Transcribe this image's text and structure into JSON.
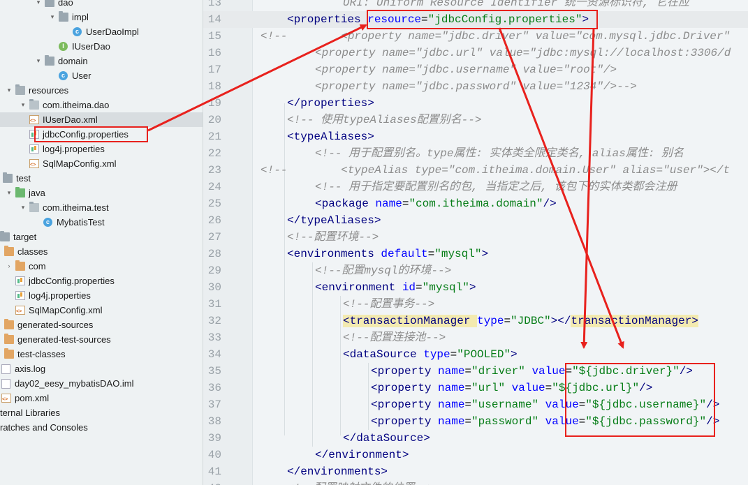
{
  "project_tree": {
    "items": [
      {
        "label": "dao",
        "icon": "folder-icon",
        "arrow": "down"
      },
      {
        "label": "impl",
        "icon": "folder-icon",
        "arrow": "down"
      },
      {
        "label": "UserDaoImpl",
        "icon": "class-icon",
        "arrow": ""
      },
      {
        "label": "IUserDao",
        "icon": "interface-icon",
        "arrow": ""
      },
      {
        "label": "domain",
        "icon": "folder-icon",
        "arrow": "down"
      },
      {
        "label": "User",
        "icon": "class-icon",
        "arrow": ""
      },
      {
        "label": "resources",
        "icon": "resources-folder-icon",
        "arrow": "down"
      },
      {
        "label": "com.itheima.dao",
        "icon": "package-icon",
        "arrow": "down"
      },
      {
        "label": "IUserDao.xml",
        "icon": "xml-file-icon",
        "arrow": ""
      },
      {
        "label": "jdbcConfig.properties",
        "icon": "properties-file-icon",
        "arrow": ""
      },
      {
        "label": "log4j.properties",
        "icon": "properties-file-icon",
        "arrow": ""
      },
      {
        "label": "SqlMapConfig.xml",
        "icon": "xml-file-icon",
        "arrow": ""
      },
      {
        "label": "test",
        "icon": "folder-icon",
        "arrow": "down"
      },
      {
        "label": "java",
        "icon": "test-folder-icon",
        "arrow": "down"
      },
      {
        "label": "com.itheima.test",
        "icon": "package-icon",
        "arrow": "down"
      },
      {
        "label": "MybatisTest",
        "icon": "class-icon",
        "arrow": ""
      },
      {
        "label": "target",
        "icon": "folder-icon",
        "arrow": "down"
      },
      {
        "label": "classes",
        "icon": "excluded-folder-icon",
        "arrow": "down"
      },
      {
        "label": "com",
        "icon": "excluded-folder-icon",
        "arrow": "right"
      },
      {
        "label": "jdbcConfig.properties",
        "icon": "properties-file-icon",
        "arrow": ""
      },
      {
        "label": "log4j.properties",
        "icon": "properties-file-icon",
        "arrow": ""
      },
      {
        "label": "SqlMapConfig.xml",
        "icon": "xml-file-icon",
        "arrow": ""
      },
      {
        "label": "generated-sources",
        "icon": "excluded-folder-icon",
        "arrow": "right"
      },
      {
        "label": "generated-test-sources",
        "icon": "excluded-folder-icon",
        "arrow": "right"
      },
      {
        "label": "test-classes",
        "icon": "excluded-folder-icon",
        "arrow": "right"
      },
      {
        "label": "axis.log",
        "icon": "file-icon",
        "arrow": ""
      },
      {
        "label": "day02_eesy_mybatisDAO.iml",
        "icon": "file-icon",
        "arrow": ""
      },
      {
        "label": "pom.xml",
        "icon": "xml-file-icon",
        "arrow": ""
      },
      {
        "label": "ternal Libraries",
        "icon": "",
        "arrow": ""
      },
      {
        "label": "ratches and Consoles",
        "icon": "",
        "arrow": ""
      }
    ]
  },
  "editor": {
    "lines": [
      {
        "n": "13",
        "tokens": [
          [
            "cmt",
            "URI: Uniform Resource Identifier 统一资源标识符, 它在应"
          ]
        ]
      },
      {
        "n": "14",
        "tokens": [
          [
            "tag",
            "<properties "
          ],
          [
            "attr",
            "resource"
          ],
          [
            "plain",
            "="
          ],
          [
            "val",
            "\"jdbcConfig.properties\""
          ],
          [
            "tag",
            ">"
          ]
        ]
      },
      {
        "n": "15",
        "tokens": [
          [
            "cmt",
            "<!--        <property name=\"jdbc.driver\" value=\"com.mysql.jdbc.Driver\""
          ]
        ]
      },
      {
        "n": "16",
        "tokens": [
          [
            "cmt",
            "<property name=\"jdbc.url\" value=\"jdbc:mysql://localhost:3306/d"
          ]
        ]
      },
      {
        "n": "17",
        "tokens": [
          [
            "cmt",
            "<property name=\"jdbc.username\" value=\"root\"/>"
          ]
        ]
      },
      {
        "n": "18",
        "tokens": [
          [
            "cmt",
            "<property name=\"jdbc.password\" value=\"1234\"/>-->"
          ]
        ]
      },
      {
        "n": "19",
        "tokens": [
          [
            "tag",
            "</properties>"
          ]
        ]
      },
      {
        "n": "20",
        "tokens": [
          [
            "cmt",
            "<!-- 使用typeAliases配置别名-->"
          ]
        ]
      },
      {
        "n": "21",
        "tokens": [
          [
            "tag",
            "<typeAliases>"
          ]
        ]
      },
      {
        "n": "22",
        "tokens": [
          [
            "cmt",
            "<!-- 用于配置别名。type属性: 实体类全限定类名, alias属性: 别名"
          ]
        ]
      },
      {
        "n": "23",
        "tokens": [
          [
            "cmt",
            "<!--        <typeAlias type=\"com.itheima.domain.User\" alias=\"user\"></t"
          ]
        ]
      },
      {
        "n": "24",
        "tokens": [
          [
            "cmt",
            "<!-- 用于指定要配置别名的包, 当指定之后, 该包下的实体类都会注册"
          ]
        ]
      },
      {
        "n": "25",
        "tokens": [
          [
            "tag",
            "<package "
          ],
          [
            "attr",
            "name"
          ],
          [
            "plain",
            "="
          ],
          [
            "val",
            "\"com.itheima.domain\""
          ],
          [
            "tag",
            "/>"
          ]
        ]
      },
      {
        "n": "26",
        "tokens": [
          [
            "tag",
            "</typeAliases>"
          ]
        ]
      },
      {
        "n": "27",
        "tokens": [
          [
            "cmt",
            "<!--配置环境-->"
          ]
        ]
      },
      {
        "n": "28",
        "tokens": [
          [
            "tag",
            "<environments "
          ],
          [
            "attr",
            "default"
          ],
          [
            "plain",
            "="
          ],
          [
            "val",
            "\"mysql\""
          ],
          [
            "tag",
            ">"
          ]
        ]
      },
      {
        "n": "29",
        "tokens": [
          [
            "cmt",
            "<!--配置mysql的环境-->"
          ]
        ]
      },
      {
        "n": "30",
        "tokens": [
          [
            "tag",
            "<environment "
          ],
          [
            "attr",
            "id"
          ],
          [
            "plain",
            "="
          ],
          [
            "val",
            "\"mysql\""
          ],
          [
            "tag",
            ">"
          ]
        ]
      },
      {
        "n": "31",
        "tokens": [
          [
            "cmt",
            "<!--配置事务-->"
          ]
        ]
      },
      {
        "n": "32",
        "tokens": [
          [
            "taghl",
            "<transactionManager "
          ],
          [
            "attr",
            "type"
          ],
          [
            "plain",
            "="
          ],
          [
            "val",
            "\"JDBC\""
          ],
          [
            "tag",
            "></"
          ],
          [
            "taghl",
            "transactionManager>"
          ]
        ]
      },
      {
        "n": "33",
        "tokens": [
          [
            "cmt",
            "<!--配置连接池-->"
          ]
        ]
      },
      {
        "n": "34",
        "tokens": [
          [
            "tag",
            "<dataSource "
          ],
          [
            "attr",
            "type"
          ],
          [
            "plain",
            "="
          ],
          [
            "val",
            "\"POOLED\""
          ],
          [
            "tag",
            ">"
          ]
        ]
      },
      {
        "n": "35",
        "tokens": [
          [
            "tag",
            "<property "
          ],
          [
            "attr",
            "name"
          ],
          [
            "plain",
            "="
          ],
          [
            "val",
            "\"driver\" "
          ],
          [
            "attr",
            "value"
          ],
          [
            "plain",
            "="
          ],
          [
            "val",
            "\"${jdbc.driver}\""
          ],
          [
            "tag",
            "/>"
          ]
        ]
      },
      {
        "n": "36",
        "tokens": [
          [
            "tag",
            "<property "
          ],
          [
            "attr",
            "name"
          ],
          [
            "plain",
            "="
          ],
          [
            "val",
            "\"url\" "
          ],
          [
            "attr",
            "value"
          ],
          [
            "plain",
            "="
          ],
          [
            "val",
            "\"${jdbc.url}\""
          ],
          [
            "tag",
            "/>"
          ]
        ]
      },
      {
        "n": "37",
        "tokens": [
          [
            "tag",
            "<property "
          ],
          [
            "attr",
            "name"
          ],
          [
            "plain",
            "="
          ],
          [
            "val",
            "\"username\" "
          ],
          [
            "attr",
            "value"
          ],
          [
            "plain",
            "="
          ],
          [
            "val",
            "\"${jdbc.username}\""
          ],
          [
            "tag",
            "/>"
          ]
        ]
      },
      {
        "n": "38",
        "tokens": [
          [
            "tag",
            "<property "
          ],
          [
            "attr",
            "name"
          ],
          [
            "plain",
            "="
          ],
          [
            "val",
            "\"password\" "
          ],
          [
            "attr",
            "value"
          ],
          [
            "plain",
            "="
          ],
          [
            "val",
            "\"${jdbc.password}\""
          ],
          [
            "tag",
            "/>"
          ]
        ]
      },
      {
        "n": "39",
        "tokens": [
          [
            "tag",
            "</dataSource>"
          ]
        ]
      },
      {
        "n": "40",
        "tokens": [
          [
            "tag",
            "</environment>"
          ]
        ]
      },
      {
        "n": "41",
        "tokens": [
          [
            "tag",
            "</environments>"
          ]
        ]
      },
      {
        "n": "42",
        "tokens": [
          [
            "cmt",
            "<!--配置映射文件的位置-->"
          ]
        ]
      }
    ]
  },
  "colors": {
    "annotation": "#e8211d",
    "tag": "#000080",
    "attribute": "#0000ff",
    "value": "#067d17",
    "comment": "#8c8c8c"
  }
}
